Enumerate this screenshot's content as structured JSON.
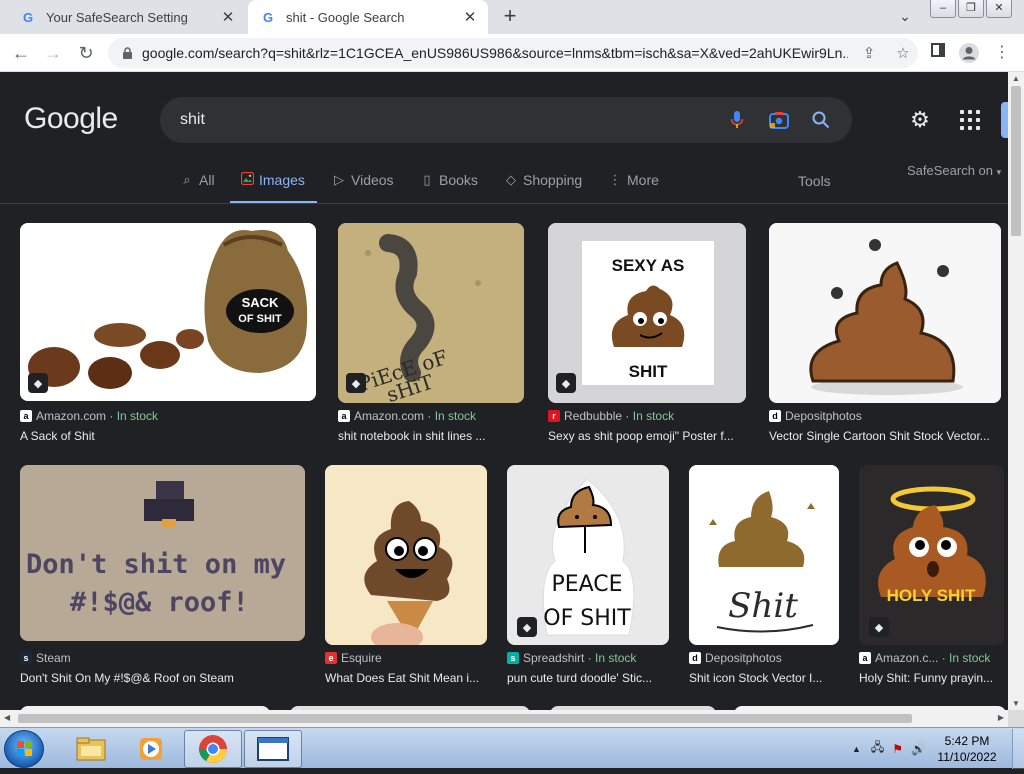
{
  "browser": {
    "tabs": [
      {
        "title": "Your SafeSearch Setting",
        "favicon": "google-g-icon",
        "active": false
      },
      {
        "title": "shit - Google Search",
        "favicon": "google-g-icon",
        "active": true
      }
    ],
    "new_tab": "+",
    "url": "google.com/search?q=shit&rlz=1C1GCEA_enUS986US986&source=lnms&tbm=isch&sa=X&ved=2ahUKEwir9Ln..."
  },
  "google": {
    "logo": "Google",
    "query": "shit",
    "nav": [
      {
        "label": "All",
        "icon": "search-icon"
      },
      {
        "label": "Images",
        "icon": "image-icon",
        "active": true
      },
      {
        "label": "Videos",
        "icon": "video-icon"
      },
      {
        "label": "Books",
        "icon": "book-icon"
      },
      {
        "label": "Shopping",
        "icon": "tag-icon"
      },
      {
        "label": "More",
        "icon": "more-vertical-icon"
      }
    ],
    "tools": "Tools",
    "safesearch": "SafeSearch on"
  },
  "results": [
    {
      "source": "Amazon.com",
      "stock": "In stock",
      "caption": "A Sack of Shit",
      "thumb_text": [
        "SACK",
        "OF SHIT"
      ],
      "thumb_bg": "#ffffff"
    },
    {
      "source": "Amazon.com",
      "stock": "In stock",
      "caption": "shit notebook in shit lines ...",
      "thumb_text": [
        "PiEcE oF",
        "sHiT"
      ],
      "thumb_bg": "#c9b98a"
    },
    {
      "source": "Redbubble",
      "stock": "In stock",
      "caption": "Sexy as shit poop emoji\" Poster f...",
      "thumb_text": [
        "SEXY AS",
        "SHIT"
      ],
      "thumb_bg": "#d9d9d9"
    },
    {
      "source": "Depositphotos",
      "stock": "",
      "caption": "Vector Single Cartoon Shit Stock Vector...",
      "thumb_text": [],
      "thumb_bg": "#f5f5f5"
    },
    {
      "source": "Steam",
      "stock": "",
      "caption": "Don't Shit On My #!$@& Roof on Steam",
      "thumb_text": [
        "Don't shit on my",
        "#!$@& roof!"
      ],
      "thumb_bg": "#b3a594"
    },
    {
      "source": "Esquire",
      "stock": "",
      "caption": "What Does Eat Shit Mean i...",
      "thumb_text": [],
      "thumb_bg": "#f4e4c1"
    },
    {
      "source": "Spreadshirt",
      "stock": "In stock",
      "caption": "pun cute turd doodle' Stic...",
      "thumb_text": [
        "PEACE",
        "OF SHIT"
      ],
      "thumb_bg": "#e6e6e6"
    },
    {
      "source": "Depositphotos",
      "stock": "",
      "caption": "Shit icon Stock Vector I...",
      "thumb_text": [
        "Shit"
      ],
      "thumb_bg": "#ffffff"
    },
    {
      "source": "Amazon.c...",
      "stock": "In stock",
      "caption": "Holy Shit: Funny prayin...",
      "thumb_text": [
        "HOLY SHIT"
      ],
      "thumb_bg": "#2c2a2a"
    }
  ],
  "taskbar": {
    "time": "5:42 PM",
    "date": "11/10/2022"
  },
  "colors": {
    "page_bg": "#202124",
    "accent": "#8ab4f8",
    "in_stock": "#81c995",
    "caption": "#e8eaed",
    "muted": "#9aa0a6"
  }
}
